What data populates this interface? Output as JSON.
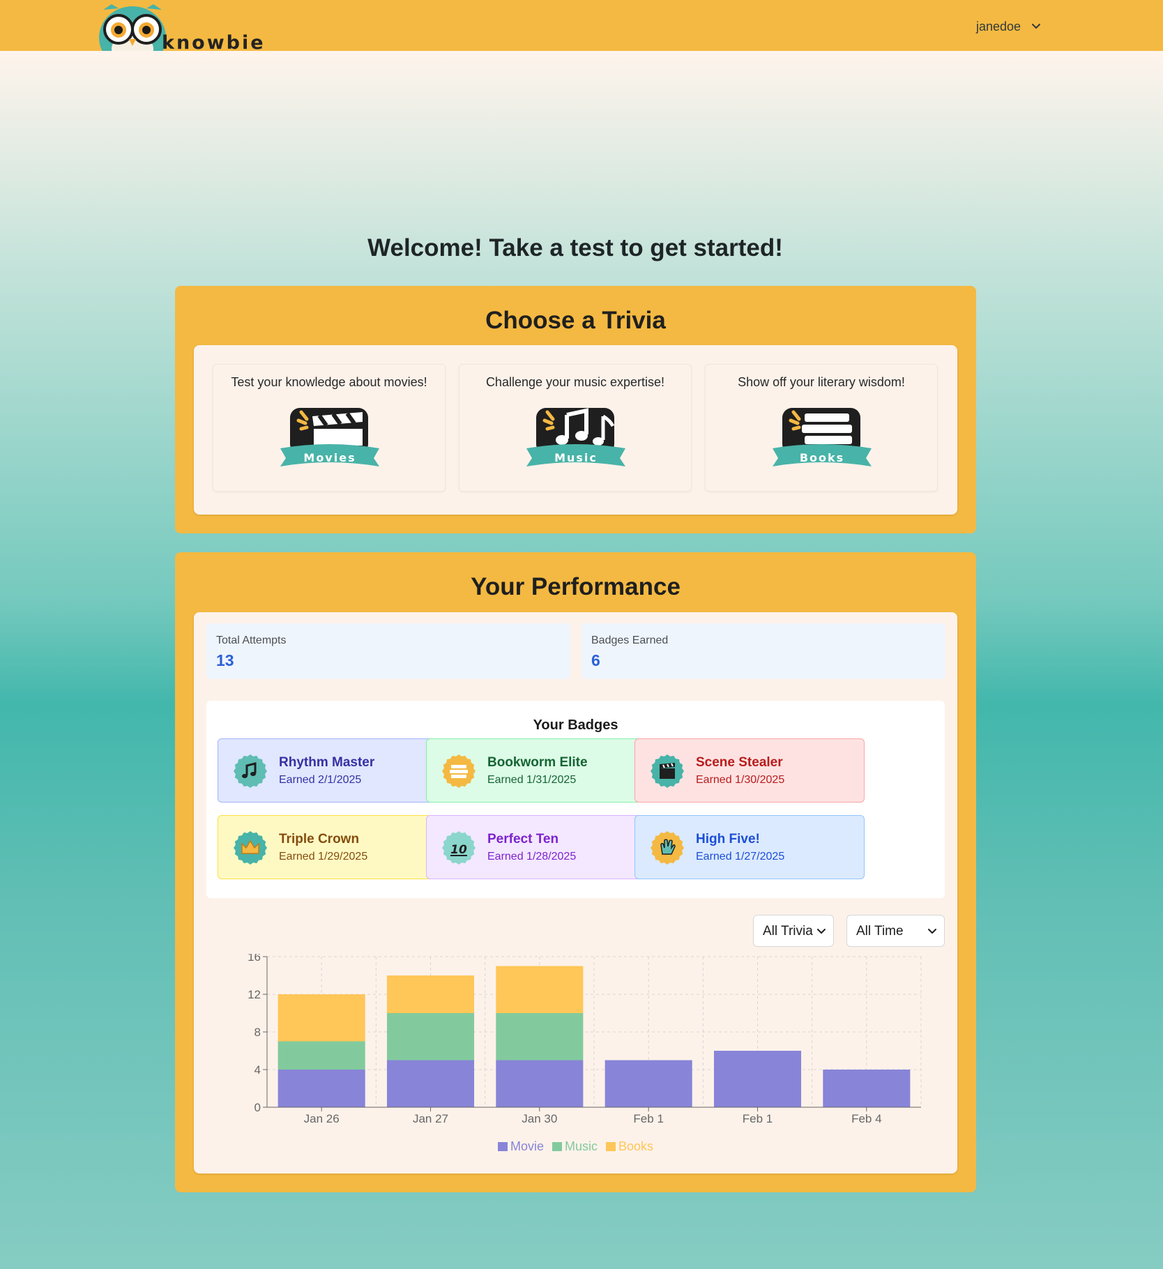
{
  "header": {
    "brand": "knowbie",
    "username": "janedoe"
  },
  "welcome": "Welcome! Take a test to get started!",
  "trivia": {
    "title": "Choose a Trivia",
    "cards": [
      {
        "description": "Test your knowledge about movies!",
        "label": "Movies",
        "icon": "clapperboard-icon"
      },
      {
        "description": "Challenge your music expertise!",
        "label": "Music",
        "icon": "music-notes-icon"
      },
      {
        "description": "Show off your literary wisdom!",
        "label": "Books",
        "icon": "books-stack-icon"
      }
    ]
  },
  "performance": {
    "title": "Your Performance",
    "stats": [
      {
        "label": "Total Attempts",
        "value": "13"
      },
      {
        "label": "Badges Earned",
        "value": "6"
      }
    ],
    "badges_title": "Your Badges",
    "badges": [
      {
        "name": "Rhythm Master",
        "earned": "Earned 2/1/2025",
        "icon": "music-notes-badge-icon",
        "bg": "#e0e7ff",
        "border": "#a5b4fc",
        "color": "#3730a3"
      },
      {
        "name": "Bookworm Elite",
        "earned": "Earned 1/31/2025",
        "icon": "books-badge-icon",
        "bg": "#dcfce7",
        "border": "#86efac",
        "color": "#166534"
      },
      {
        "name": "Scene Stealer",
        "earned": "Earned 1/30/2025",
        "icon": "clapperboard-badge-icon",
        "bg": "#fee2e2",
        "border": "#fca5a5",
        "color": "#b91c1c"
      },
      {
        "name": "Triple Crown",
        "earned": "Earned 1/29/2025",
        "icon": "crown-badge-icon",
        "bg": "#fef9c3",
        "border": "#fde047",
        "color": "#854d0e"
      },
      {
        "name": "Perfect Ten",
        "earned": "Earned 1/28/2025",
        "icon": "ten-badge-icon",
        "bg": "#f3e8ff",
        "border": "#d8b4fe",
        "color": "#7e22ce"
      },
      {
        "name": "High Five!",
        "earned": "Earned 1/27/2025",
        "icon": "high-five-badge-icon",
        "bg": "#dbeafe",
        "border": "#93c5fd",
        "color": "#1d4ed8"
      }
    ],
    "filters": {
      "trivia": "All Trivia",
      "time": "All Time"
    }
  },
  "chart_data": {
    "type": "bar",
    "stacked": true,
    "categories": [
      "Jan 26",
      "Jan 27",
      "Jan 30",
      "Feb 1",
      "Feb 1",
      "Feb 4"
    ],
    "series": [
      {
        "name": "Movie",
        "color": "#8884d8",
        "values": [
          4,
          5,
          5,
          5,
          6,
          4
        ]
      },
      {
        "name": "Music",
        "color": "#82ca9d",
        "values": [
          3,
          5,
          5,
          0,
          0,
          0
        ]
      },
      {
        "name": "Books",
        "color": "#ffc658",
        "values": [
          5,
          4,
          5,
          0,
          0,
          0
        ]
      }
    ],
    "yticks": [
      0,
      4,
      8,
      12,
      16
    ],
    "ylim": [
      0,
      16
    ],
    "grid": true,
    "legend_position": "bottom"
  }
}
